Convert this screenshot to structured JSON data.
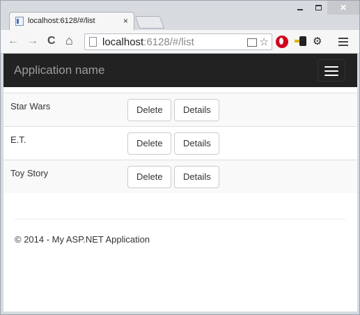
{
  "browser": {
    "tab_title": "localhost:6128/#/list",
    "tab_close": "×",
    "url_host": "localhost",
    "url_rest": ":6128/#/list",
    "back": "←",
    "forward": "→",
    "reload": "C",
    "home": "⌂",
    "reader_icon": "reader-mode-icon",
    "star": "☆",
    "gear": "⚙",
    "close_glyph": "✕"
  },
  "app": {
    "brand": "Application name",
    "rows": [
      {
        "title": "Star Wars",
        "delete_label": "Delete",
        "details_label": "Details"
      },
      {
        "title": "E.T.",
        "delete_label": "Delete",
        "details_label": "Details"
      },
      {
        "title": "Toy Story",
        "delete_label": "Delete",
        "details_label": "Details"
      }
    ],
    "footer": "© 2014 - My ASP.NET Application"
  },
  "colors": {
    "navbar": "#222222",
    "brand_text": "#9d9d9d",
    "row_stripe": "#f9f9f9",
    "button_border": "#cccccc"
  }
}
